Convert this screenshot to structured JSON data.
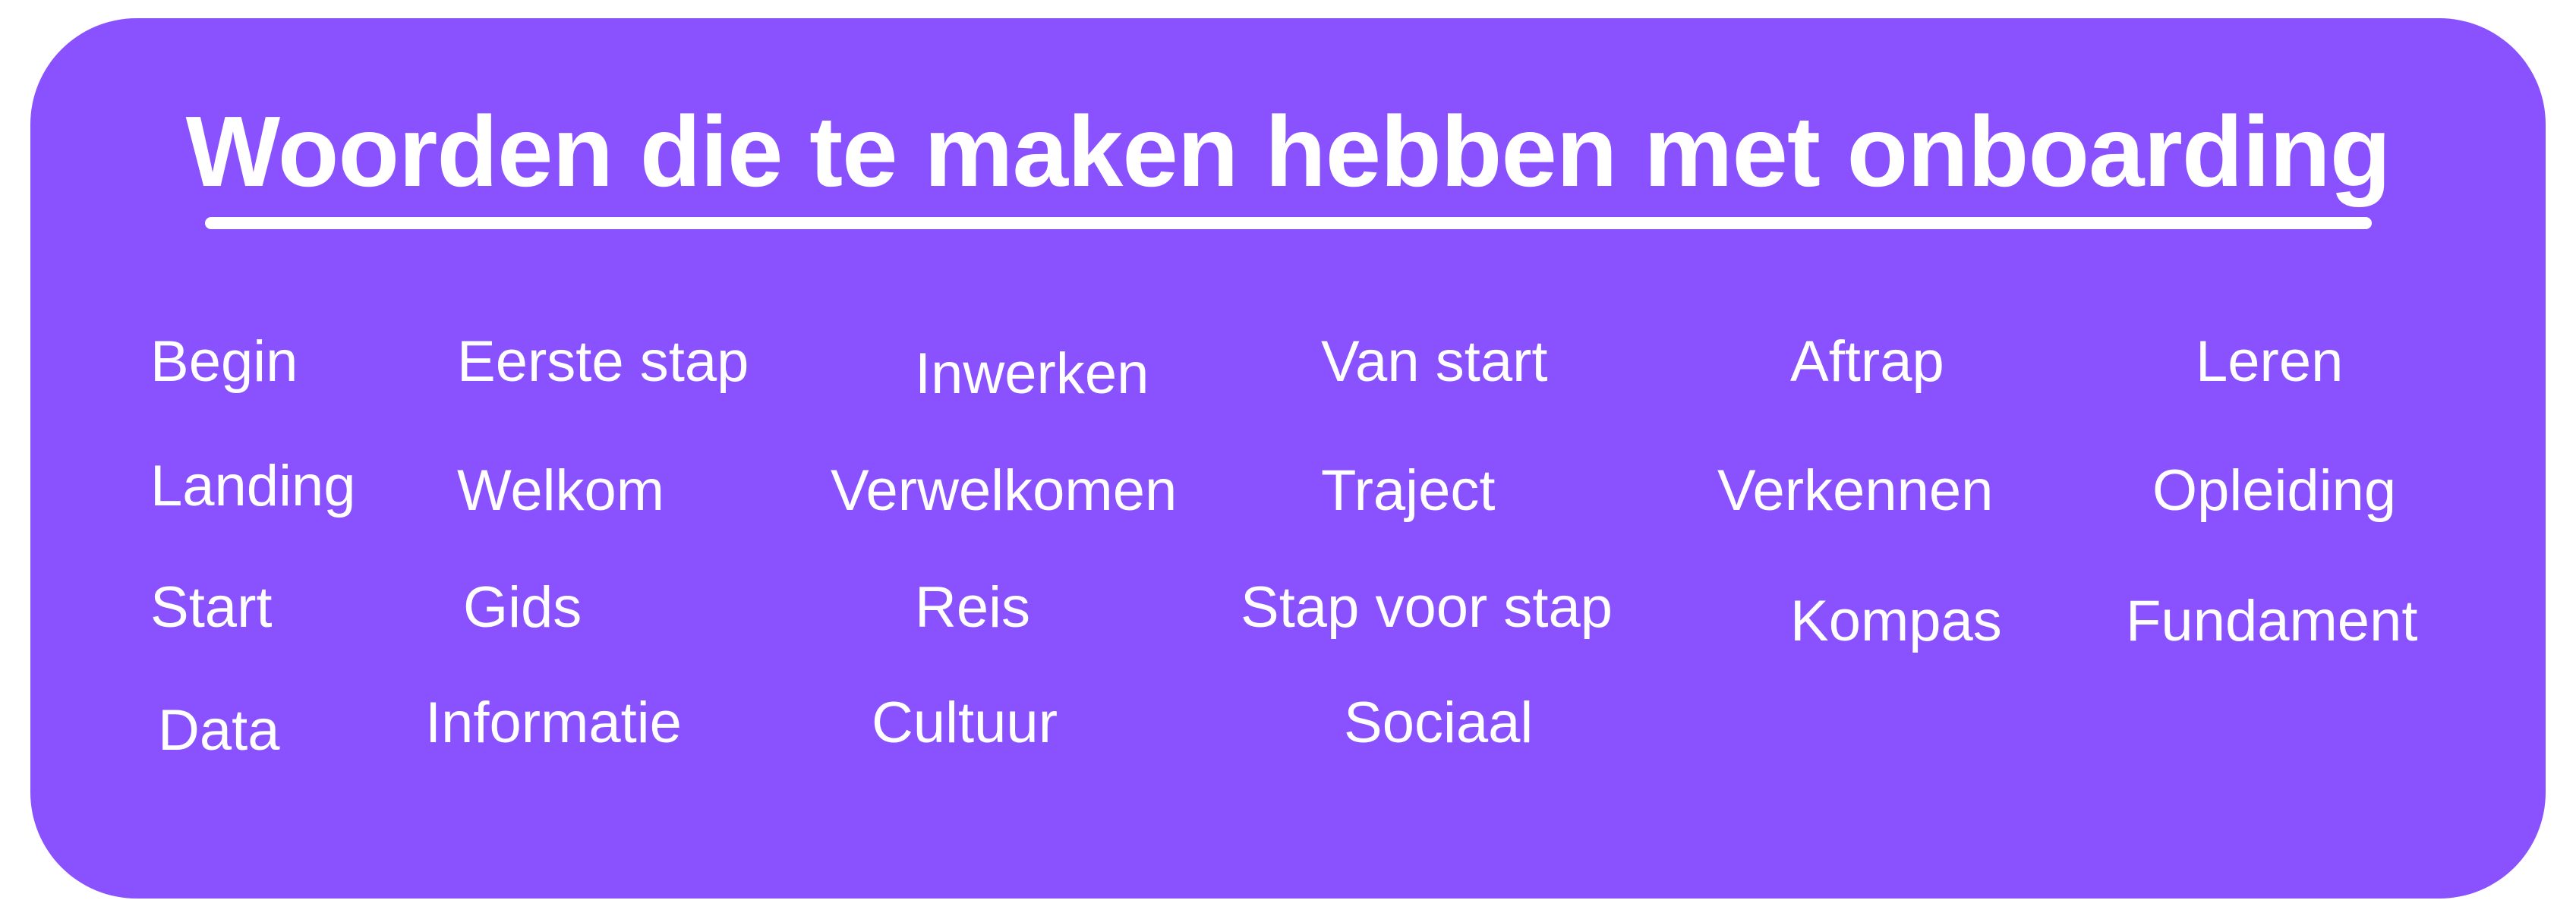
{
  "title": "Woorden die te maken hebben met onboarding",
  "colors": {
    "card_background": "#8a52fe",
    "text": "#ffffff",
    "page_background": "#ffffff"
  },
  "words": [
    "Begin",
    "Eerste stap",
    "Inwerken",
    "Van start",
    "Aftrap",
    "Leren",
    "Landing",
    "Welkom",
    "Verwelkomen",
    "Traject",
    "Verkennen",
    "Opleiding",
    "Start",
    "Gids",
    "Reis",
    "Stap voor stap",
    "Kompas",
    "Fundament",
    "Data",
    "Informatie",
    "Cultuur",
    "Sociaal"
  ]
}
